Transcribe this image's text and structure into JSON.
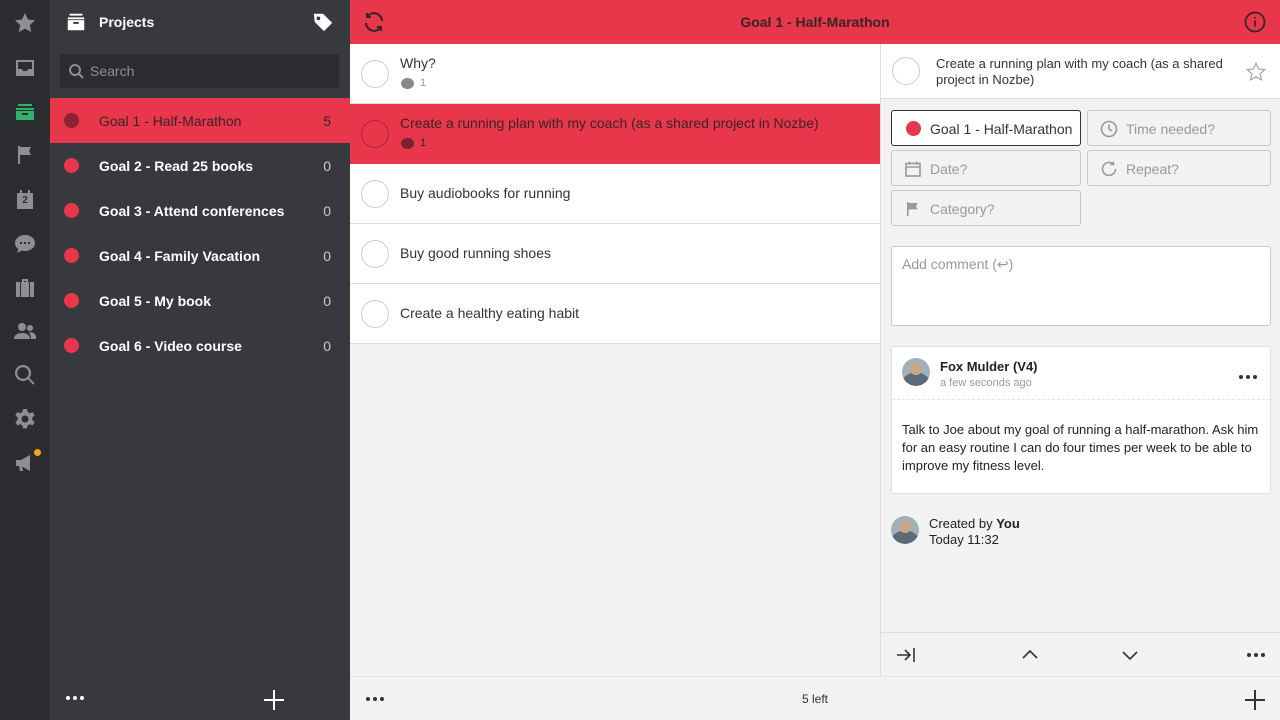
{
  "colors": {
    "accent": "#e8364a",
    "rail_bg": "#2b2d31",
    "panel_bg": "#37393e",
    "active_icon": "#2fb36b",
    "notification": "#f4a21e"
  },
  "rail": {
    "items": [
      {
        "icon": "star-icon"
      },
      {
        "icon": "inbox-icon"
      },
      {
        "icon": "projects-icon",
        "active": true
      },
      {
        "icon": "flag-icon"
      },
      {
        "icon": "calendar-icon",
        "badge": "2"
      },
      {
        "icon": "comments-icon"
      },
      {
        "icon": "briefcase-icon"
      },
      {
        "icon": "team-icon"
      },
      {
        "icon": "search-icon"
      },
      {
        "icon": "gear-icon"
      },
      {
        "icon": "megaphone-icon",
        "notification": true
      }
    ]
  },
  "projects_panel": {
    "title": "Projects",
    "search_placeholder": "Search",
    "items": [
      {
        "name": "Goal 1 - Half-Marathon",
        "count": "5",
        "active": true
      },
      {
        "name": "Goal 2 - Read 25 books",
        "count": "0"
      },
      {
        "name": "Goal 3 - Attend conferences",
        "count": "0"
      },
      {
        "name": "Goal 4 - Family Vacation",
        "count": "0"
      },
      {
        "name": "Goal 5 - My book",
        "count": "0"
      },
      {
        "name": "Goal 6 - Video course",
        "count": "0"
      }
    ]
  },
  "topbar": {
    "title": "Goal 1 - Half-Marathon"
  },
  "tasks": [
    {
      "text": "Why?",
      "comments": "1"
    },
    {
      "text": "Create a running plan with my coach (as a shared project in Nozbe)",
      "comments": "1",
      "active": true
    },
    {
      "text": "Buy audiobooks for running"
    },
    {
      "text": "Buy good running shoes"
    },
    {
      "text": "Create a healthy eating habit"
    }
  ],
  "bottombar": {
    "left_count": "5 left"
  },
  "detail": {
    "title": "Create a running plan with my coach (as a shared project in Nozbe)",
    "fields": {
      "project": "Goal 1 - Half-Marathon",
      "time_needed": "Time needed?",
      "date": "Date?",
      "repeat": "Repeat?",
      "category": "Category?"
    },
    "comment_placeholder": "Add comment (↩)",
    "comment": {
      "author": "Fox Mulder (V4)",
      "time": "a few seconds ago",
      "body": "Talk to Joe about my goal of running a half-marathon. Ask him for an easy routine I can do four times per week to be able to improve my fitness level."
    },
    "created": {
      "prefix": "Created by",
      "by": "You",
      "time": "Today 11:32"
    }
  }
}
